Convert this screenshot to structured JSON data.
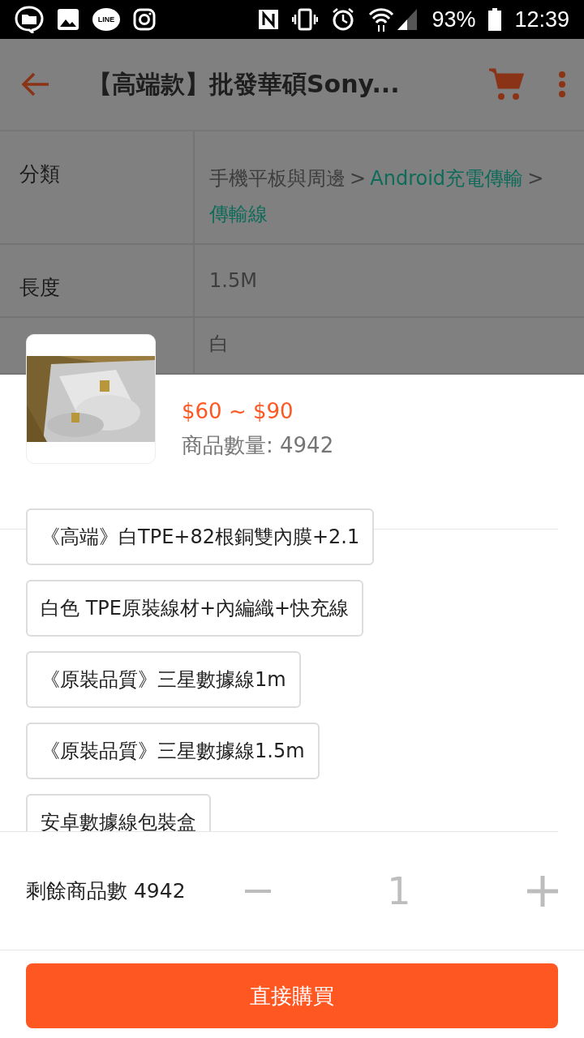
{
  "status_bar": {
    "app_badge": "LINE",
    "battery": "93%",
    "time": "12:39"
  },
  "toolbar": {
    "title": "【高端款】批發華碩Sony..."
  },
  "spec_table": [
    {
      "label": "分類",
      "path": [
        {
          "text": "手機平板與周邊",
          "kind": "plain"
        },
        {
          "text": ">",
          "kind": "separator"
        },
        {
          "text": "Android充電傳輸",
          "kind": "link"
        },
        {
          "text": ">",
          "kind": "separator"
        },
        {
          "text": "傳輸線",
          "kind": "link"
        }
      ]
    },
    {
      "label": "長度",
      "value": "1.5M"
    },
    {
      "value": "白"
    }
  ],
  "sheet": {
    "price": "$60 ~ $90",
    "stock": "商品數量: 4942",
    "options": [
      {
        "label": "《高端》白TPE+82根銅雙內膜+2.1",
        "selected": false
      },
      {
        "label": "白色 TPE原裝線材+內編織+快充線",
        "selected": false
      },
      {
        "label": "《原裝品質》三星數據線1m",
        "selected": false
      },
      {
        "label": "《原裝品質》三星數據線1.5m",
        "selected": false
      },
      {
        "label": "安卓數據線包裝盒",
        "selected": false
      }
    ],
    "remaining": "剩餘商品數 4942",
    "quantity": "1",
    "buy_button": "直接購買"
  }
}
